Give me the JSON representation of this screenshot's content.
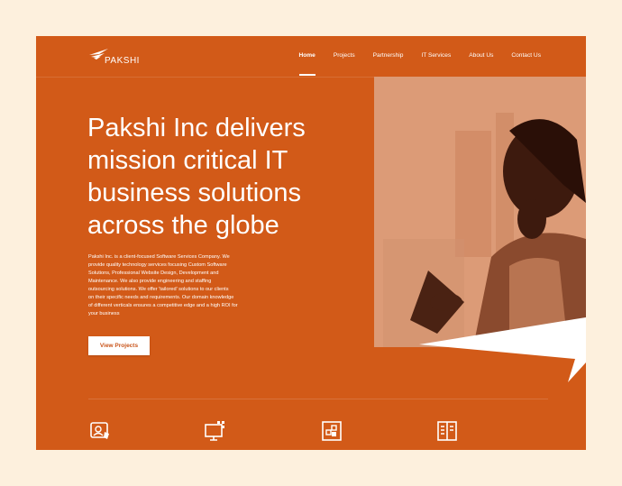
{
  "brand": {
    "name": "PAKSHI",
    "accent_color": "#d25a18",
    "page_background": "#fdf0dd"
  },
  "nav": {
    "items": [
      {
        "label": "Home",
        "active": true
      },
      {
        "label": "Projects",
        "active": false
      },
      {
        "label": "Partnership",
        "active": false
      },
      {
        "label": "IT Services",
        "active": false
      },
      {
        "label": "About Us",
        "active": false
      },
      {
        "label": "Contact Us",
        "active": false
      }
    ]
  },
  "hero": {
    "title_lines": [
      "Pakshi Inc delivers",
      "mission critical IT",
      "business solutions",
      "across the globe"
    ],
    "description_lines": [
      "Pakshi Inc. is a client-focused Software Services Company. We",
      "provide quality technology services focusing Custom Software",
      "Solutions, Professional Website Design, Development and",
      "Maintenance. We also provide engineering and staffing",
      "outsourcing solutions. We offer 'tailored' solutions to our clients",
      "on their specific needs and requirements. Our domain knowledge",
      "of different verticals ensures a competitive edge and a high ROI for",
      "your business"
    ],
    "cta_label": "View Projects"
  },
  "features": {
    "icons": [
      "support-agent-icon",
      "monitor-grid-icon",
      "dashboard-grid-icon",
      "open-book-icon"
    ]
  }
}
